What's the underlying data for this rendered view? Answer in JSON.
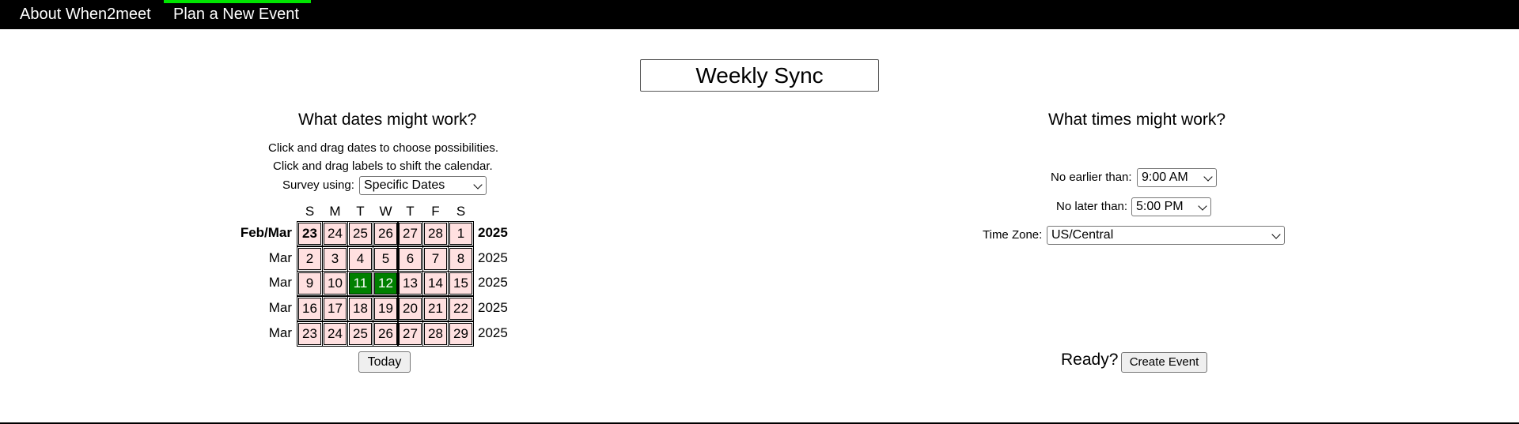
{
  "nav": {
    "about": "About When2meet",
    "plan": "Plan a New Event",
    "active_color": "#00e400"
  },
  "event": {
    "name": "Weekly Sync"
  },
  "dates": {
    "heading": "What dates might work?",
    "instruction1": "Click and drag dates to choose possibilities.",
    "instruction2": "Click and drag labels to shift the calendar.",
    "survey_label": "Survey using:",
    "survey_value": "Specific Dates",
    "days_of_week": [
      "S",
      "M",
      "T",
      "W",
      "T",
      "F",
      "S"
    ],
    "rows": [
      {
        "label": "Feb/Mar",
        "year": "2025",
        "bold": true,
        "days": [
          "23",
          "24",
          "25",
          "26",
          "27",
          "28",
          "1"
        ]
      },
      {
        "label": "Mar",
        "year": "2025",
        "bold": false,
        "days": [
          "2",
          "3",
          "4",
          "5",
          "6",
          "7",
          "8"
        ]
      },
      {
        "label": "Mar",
        "year": "2025",
        "bold": false,
        "days": [
          "9",
          "10",
          "11",
          "12",
          "13",
          "14",
          "15"
        ]
      },
      {
        "label": "Mar",
        "year": "2025",
        "bold": false,
        "days": [
          "16",
          "17",
          "18",
          "19",
          "20",
          "21",
          "22"
        ]
      },
      {
        "label": "Mar",
        "year": "2025",
        "bold": false,
        "days": [
          "23",
          "24",
          "25",
          "26",
          "27",
          "28",
          "29"
        ]
      }
    ],
    "today_cell": [
      0,
      0
    ],
    "selected_cells": [
      [
        2,
        2
      ],
      [
        2,
        3
      ]
    ],
    "unselected_color": "#ffe0e0",
    "selected_color": "#008000",
    "today_button": "Today"
  },
  "times": {
    "heading": "What times might work?",
    "no_earlier_label": "No earlier than:",
    "no_earlier_value": "9:00 AM",
    "no_later_label": "No later than:",
    "no_later_value": "5:00 PM",
    "timezone_label": "Time Zone:",
    "timezone_value": "US/Central"
  },
  "submit": {
    "ready_label": "Ready?",
    "create_button": "Create Event"
  }
}
